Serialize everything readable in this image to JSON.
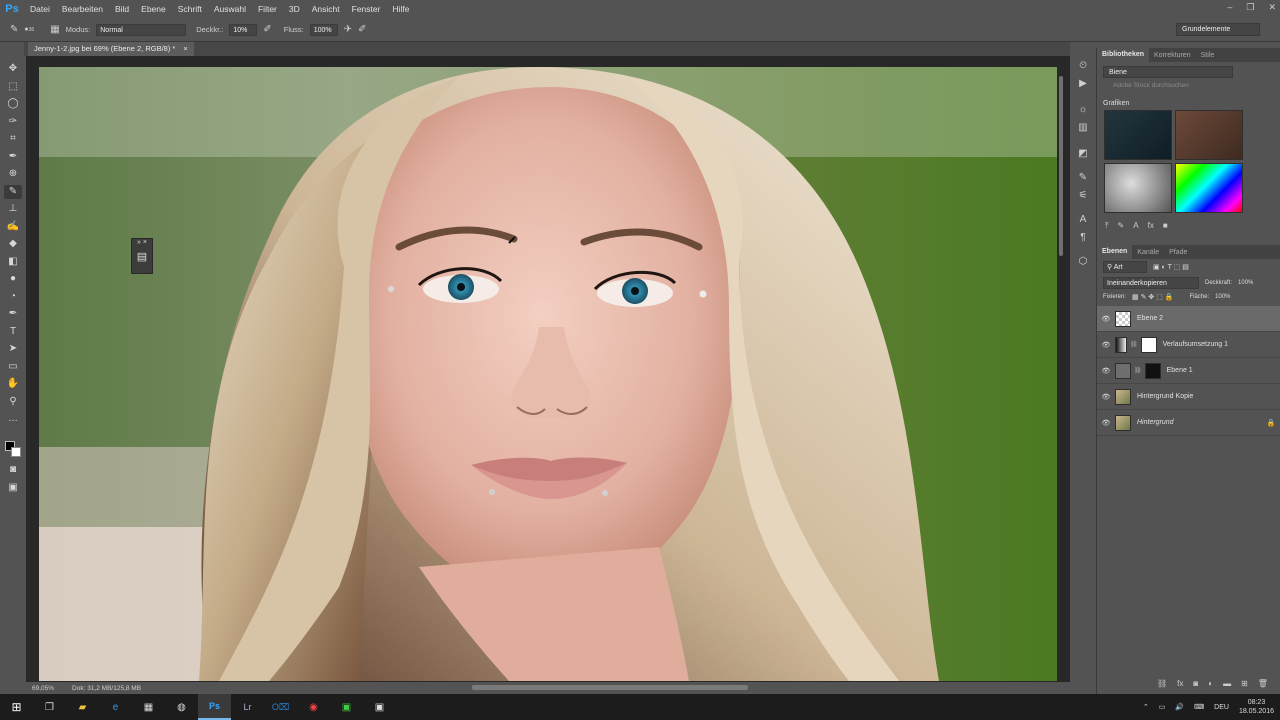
{
  "app": {
    "logo": "Ps"
  },
  "menu": [
    "Datei",
    "Bearbeiten",
    "Bild",
    "Ebene",
    "Schrift",
    "Auswahl",
    "Filter",
    "3D",
    "Ansicht",
    "Fenster",
    "Hilfe"
  ],
  "options": {
    "brush_size": "36",
    "mode_label": "Modus:",
    "mode_value": "Normal",
    "opacity_label": "Deckkr.:",
    "opacity_value": "10%",
    "flow_label": "Fluss:",
    "flow_value": "100%"
  },
  "workspace": "Grundelemente",
  "document_tab": {
    "title": "Jenny-1-2.jpg bei 69% (Ebene 2, RGB/8) *",
    "close": "×"
  },
  "status": {
    "zoom": "69,05%",
    "doc": "Dok: 31,2 MB/125,8 MB"
  },
  "libraries": {
    "tabs": [
      "Bibliotheken",
      "Korrekturen",
      "Stile"
    ],
    "selected_library": "Biene",
    "search_placeholder": "Adobe Stock durchsuchen",
    "section_heading": "Grafiken"
  },
  "layers_panel": {
    "tabs": [
      "Ebenen",
      "Kanäle",
      "Pfade"
    ],
    "filter_label": "Art",
    "blend_mode": "Ineinanderkopieren",
    "opacity_label": "Deckkraft:",
    "opacity_value": "100%",
    "lock_label": "Fixieren:",
    "fill_label": "Fläche:",
    "fill_value": "100%",
    "layers": [
      {
        "name": "Ebene 2",
        "active": true
      },
      {
        "name": "Verlaufsumsetzung 1",
        "active": false
      },
      {
        "name": "Ebene 1",
        "active": false
      },
      {
        "name": "Hintergrund Kopie",
        "active": false
      },
      {
        "name": "Hintergrund",
        "active": false,
        "locked": true
      }
    ]
  },
  "taskbar": {
    "lang": "DEU",
    "time": "08:23",
    "date": "18.05.2016"
  },
  "colors": {
    "accent": "#31a8ff",
    "panel": "#535353",
    "active_layer": "#6a6a6a"
  }
}
